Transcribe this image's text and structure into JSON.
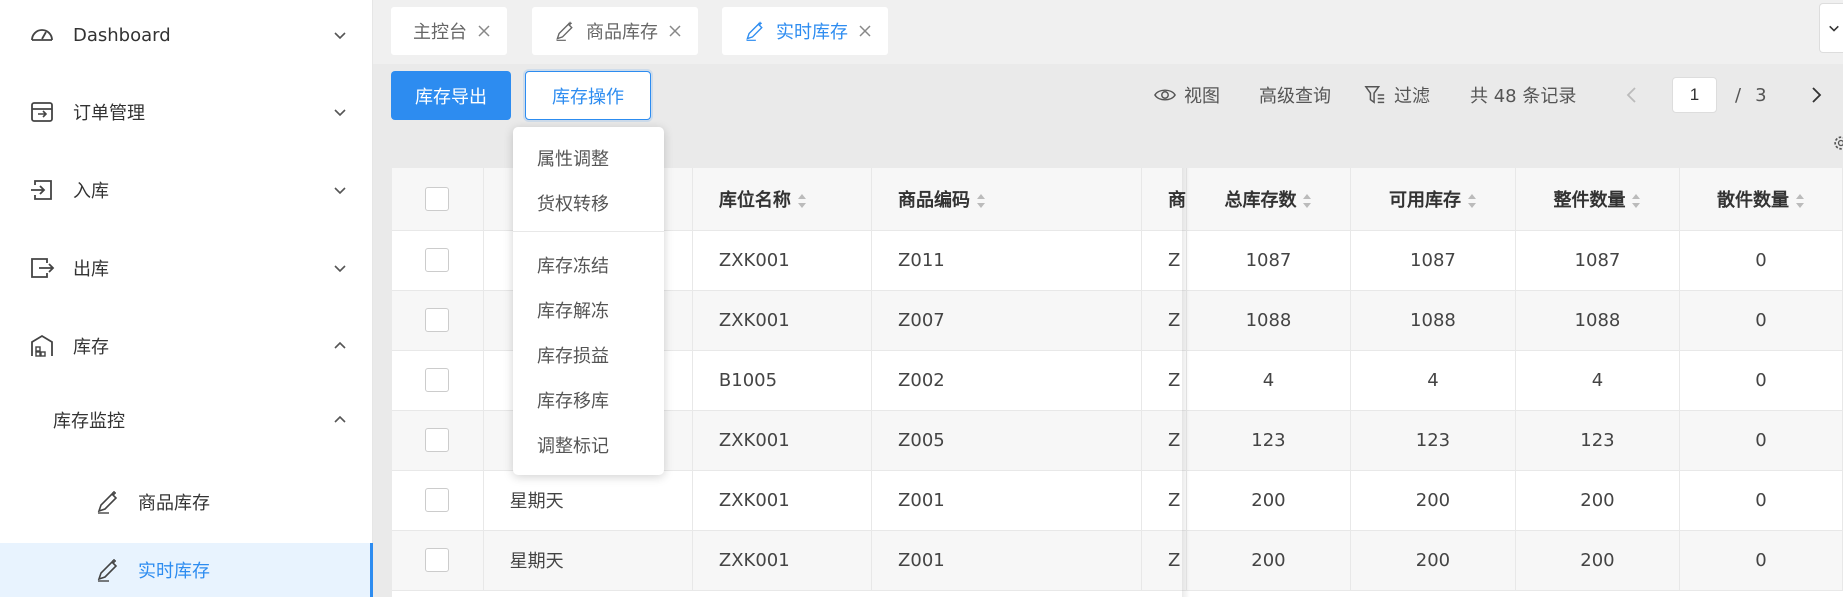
{
  "sidebar": {
    "items": [
      {
        "label": "Dashboard"
      },
      {
        "label": "订单管理"
      },
      {
        "label": "入库"
      },
      {
        "label": "出库"
      },
      {
        "label": "库存"
      },
      {
        "label": "库存监控"
      },
      {
        "label": "商品库存"
      },
      {
        "label": "实时库存"
      }
    ]
  },
  "tabs": [
    {
      "label": "主控台"
    },
    {
      "label": "商品库存"
    },
    {
      "label": "实时库存"
    }
  ],
  "toolbar": {
    "export_label": "库存导出",
    "ops_label": "库存操作",
    "view_label": "视图",
    "advanced_label": "高级查询",
    "filter_label": "过滤",
    "records_text": "共 48 条记录"
  },
  "pagination": {
    "current": "1",
    "separator": "/",
    "total_pages": "3"
  },
  "dropdown": {
    "items": [
      "属性调整",
      "货权转移",
      "库存冻结",
      "库存解冻",
      "库存损益",
      "库存移库",
      "调整标记"
    ]
  },
  "table": {
    "headers": [
      "",
      "",
      "库位名称",
      "商品编码",
      "商",
      "总库存数",
      "可用库存",
      "整件数量",
      "散件数量"
    ],
    "rows": [
      {
        "c1": "",
        "c2": "ZXK001",
        "c3": "Z011",
        "c4": "Z",
        "c5": "1087",
        "c6": "1087",
        "c7": "1087",
        "c8": "0"
      },
      {
        "c1": "",
        "c2": "ZXK001",
        "c3": "Z007",
        "c4": "Z",
        "c5": "1088",
        "c6": "1088",
        "c7": "1088",
        "c8": "0"
      },
      {
        "c1": "",
        "c2": "B1005",
        "c3": "Z002",
        "c4": "Z",
        "c5": "4",
        "c6": "4",
        "c7": "4",
        "c8": "0"
      },
      {
        "c1": "",
        "c2": "ZXK001",
        "c3": "Z005",
        "c4": "Z",
        "c5": "123",
        "c6": "123",
        "c7": "123",
        "c8": "0"
      },
      {
        "c1": "星期天",
        "c2": "ZXK001",
        "c3": "Z001",
        "c4": "Z",
        "c5": "200",
        "c6": "200",
        "c7": "200",
        "c8": "0"
      },
      {
        "c1": "星期天",
        "c2": "ZXK001",
        "c3": "Z001",
        "c4": "Z",
        "c5": "200",
        "c6": "200",
        "c7": "200",
        "c8": "0"
      }
    ]
  },
  "colors": {
    "accent": "#2d8cf0",
    "active_bg": "#e8f3fe"
  }
}
